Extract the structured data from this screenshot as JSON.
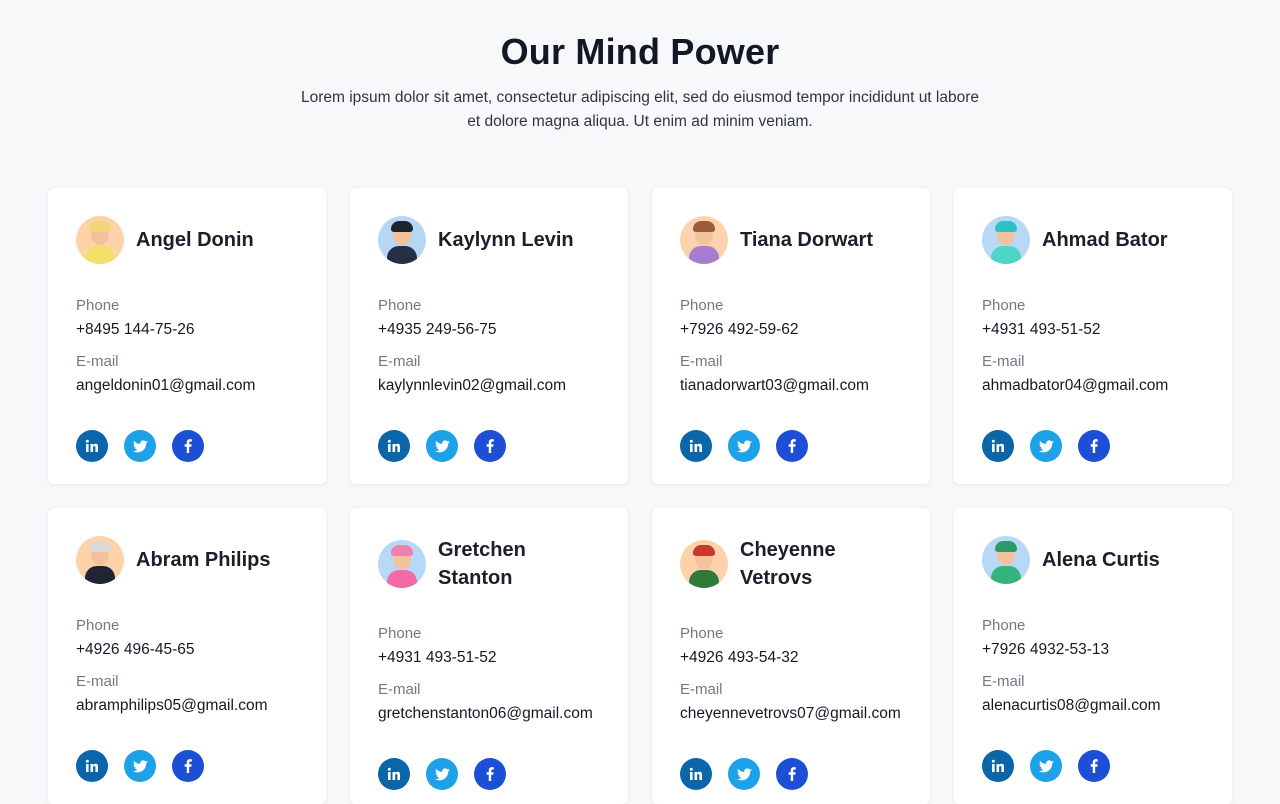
{
  "header": {
    "title": "Our Mind Power",
    "subtitle": "Lorem ipsum dolor sit amet, consectetur adipiscing elit, sed do eiusmod tempor incididunt ut labore et dolore magna aliqua. Ut enim ad minim veniam."
  },
  "labels": {
    "phone": "Phone",
    "email": "E-mail"
  },
  "colors": {
    "linkedin": "#0a66a8",
    "twitter": "#1da1e8",
    "facebook": "#1d4fd6",
    "avatar_peach": "#fcd3ae",
    "avatar_blue": "#b7d8f7"
  },
  "team": [
    {
      "name": "Angel Donin",
      "phone": "+8495 144-75-26",
      "email": "angeldonin01@gmail.com",
      "avatar_bg": "#fdd2a9",
      "hair": "#f4d57a",
      "shirt": "#f2e06a"
    },
    {
      "name": "Kaylynn Levin",
      "phone": "+4935 249-56-75",
      "email": "kaylynnlevin02@gmail.com",
      "avatar_bg": "#b7d6f6",
      "hair": "#1e2330",
      "shirt": "#253047"
    },
    {
      "name": "Tiana Dorwart",
      "phone": "+7926 492-59-62",
      "email": "tianadorwart03@gmail.com",
      "avatar_bg": "#fcd3ae",
      "hair": "#9c5a3a",
      "shirt": "#a77ccf"
    },
    {
      "name": "Ahmad Bator",
      "phone": "+4931 493-51-52",
      "email": "ahmadbator04@gmail.com",
      "avatar_bg": "#b7d8f7",
      "hair": "#2cc1c4",
      "shirt": "#4fd4c8"
    },
    {
      "name": "Abram Philips",
      "phone": "+4926 496-45-65",
      "email": "abramphilips05@gmail.com",
      "avatar_bg": "#fdd2a9",
      "hair": "#d9d9d9",
      "shirt": "#1f2533"
    },
    {
      "name": "Gretchen Stanton",
      "phone": "+4931 493-51-52",
      "email": "gretchenstanton06@gmail.com",
      "avatar_bg": "#b7d8f7",
      "hair": "#f27fb2",
      "shirt": "#f26aa6"
    },
    {
      "name": "Cheyenne Vetrovs",
      "phone": "+4926 493-54-32",
      "email": "cheyennevetrovs07@gmail.com",
      "avatar_bg": "#fdd2a9",
      "hair": "#c73a2b",
      "shirt": "#2f7a3b"
    },
    {
      "name": "Alena Curtis",
      "phone": "+7926 4932-53-13",
      "email": "alenacurtis08@gmail.com",
      "avatar_bg": "#b7d8f7",
      "hair": "#2a9a6a",
      "shirt": "#35b37d"
    }
  ],
  "icons": {
    "linkedin": "linkedin-icon",
    "twitter": "twitter-icon",
    "facebook": "facebook-icon"
  }
}
